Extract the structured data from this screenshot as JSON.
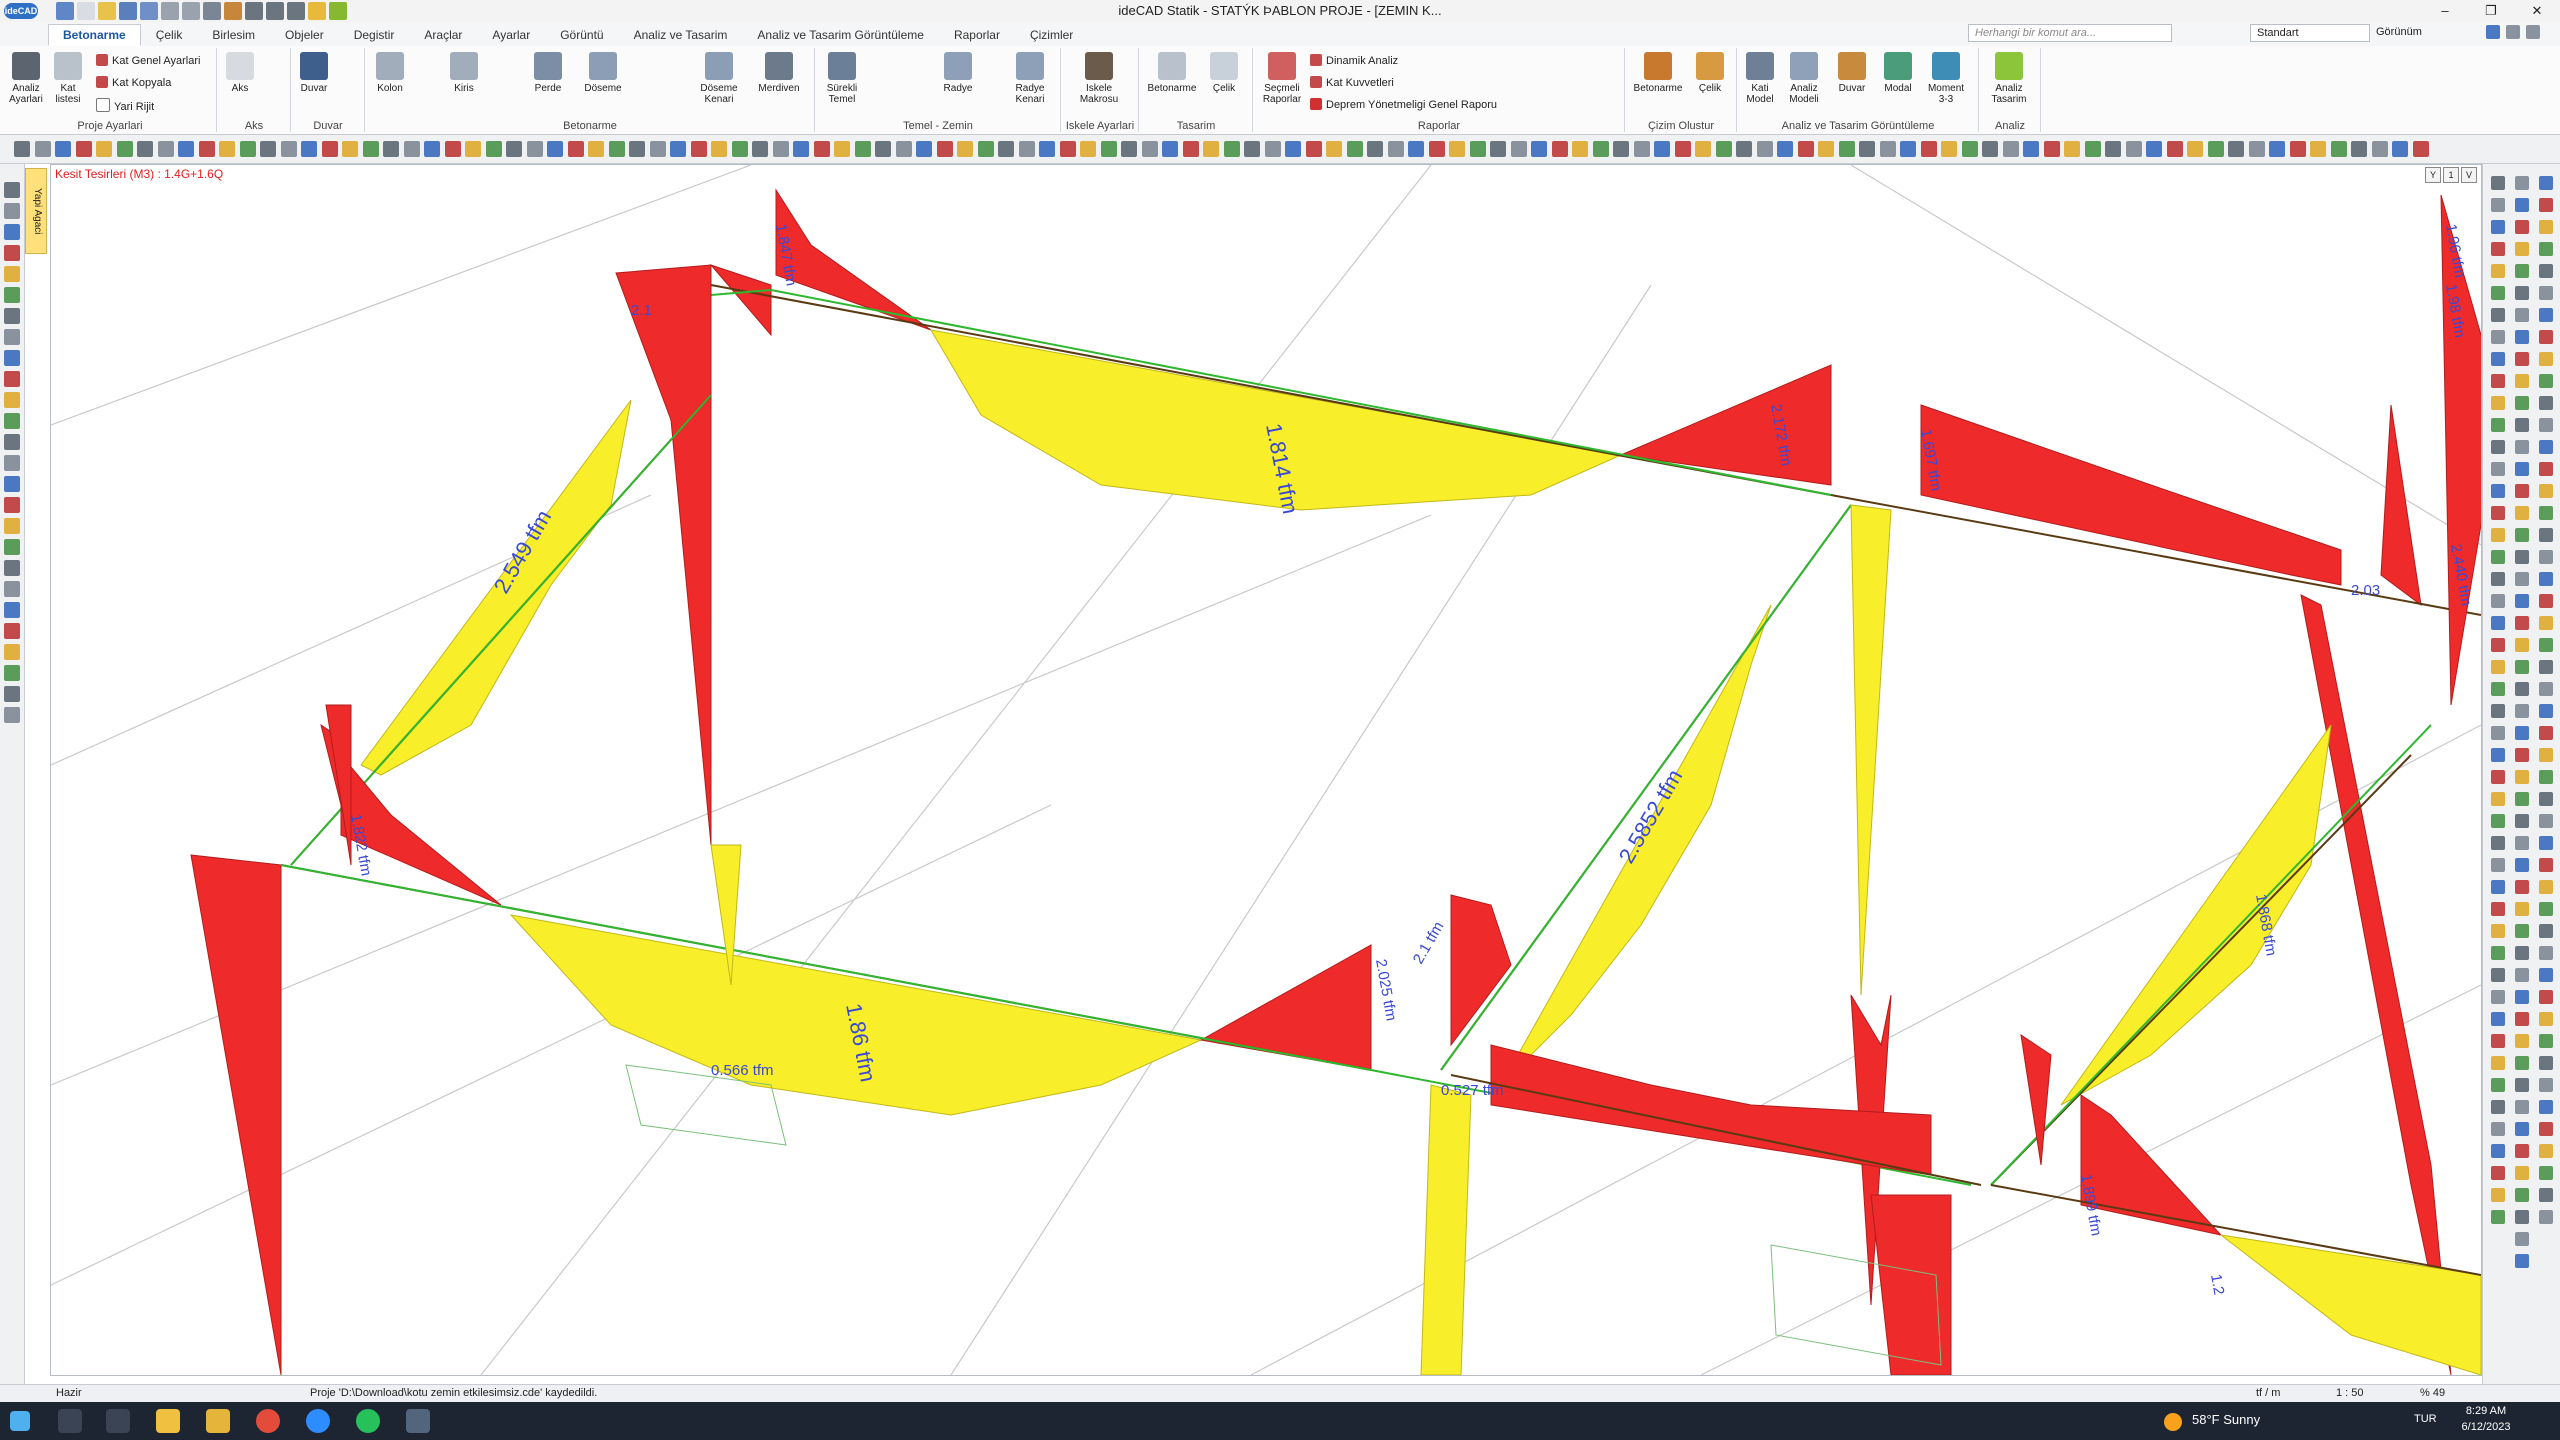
{
  "app": {
    "logo": "ideCAD",
    "window_title": "ideCAD Statik - STATÝK ÞABLON PROJE - [ZEMIN K..."
  },
  "window_controls": {
    "minimize": "–",
    "restore": "❐",
    "close": "✕"
  },
  "ribbon_tabs": [
    "Betonarme",
    "Çelik",
    "Birlesim",
    "Objeler",
    "Degistir",
    "Araçlar",
    "Ayarlar",
    "Görüntü",
    "Analiz ve Tasarim",
    "Analiz ve Tasarim Görüntüleme",
    "Raporlar",
    "Çizimler"
  ],
  "active_tab": "Betonarme",
  "search": {
    "placeholder": "Herhangi bir komut ara..."
  },
  "style_select": {
    "value": "Standart"
  },
  "view_label": "Görünüm",
  "ribbon": {
    "proje_ayarlari": {
      "label": "Proje Ayarlari",
      "analiz_ayarlari": "Analiz Ayarlari",
      "kat_listesi": "Kat listesi",
      "kat_genel_ayarlari": "Kat Genel Ayarlari",
      "kat_kopyala": "Kat Kopyala",
      "yari_rijit": "Yari Rijit"
    },
    "aks": {
      "label": "Aks",
      "aks_button": "Aks"
    },
    "duvar": {
      "label": "Duvar",
      "duvar_button": "Duvar"
    },
    "betonarme": {
      "label": "Betonarme",
      "kolon": "Kolon",
      "kiris": "Kiris",
      "perde": "Perde",
      "doseme": "Döseme",
      "doseme_kenari": "Döseme Kenari",
      "merdiven": "Merdiven"
    },
    "temel": {
      "label": "Temel - Zemin",
      "surekli_temel": "Sürekli Temel",
      "radye": "Radye",
      "radye_kenari": "Radye Kenari"
    },
    "iskele": {
      "label": "Iskele Ayarlari",
      "iskele_makrosu": "Iskele Makrosu"
    },
    "tasarim": {
      "label": "Tasarim",
      "betonarme": "Betonarme",
      "celik": "Çelik"
    },
    "raporlar": {
      "label": "Raporlar",
      "secmeli_raporlar": "Seçmeli Raporlar",
      "dinamik_analiz": "Dinamik Analiz",
      "kat_kuvvetleri": "Kat Kuvvetleri",
      "deprem_raporu": "Deprem Yönetmeligi Genel Raporu"
    },
    "cizim": {
      "label": "Çizim Olustur",
      "betonarme": "Betonarme",
      "celik": "Çelik"
    },
    "analiz_gor": {
      "label": "Analiz ve Tasarim Görüntüleme",
      "kati_model": "Kati Model",
      "analiz_modeli": "Analiz Modeli",
      "duvar": "Duvar",
      "modal": "Modal",
      "moment": "Moment 3-3"
    },
    "analiz": {
      "label": "Analiz",
      "analiz_tasarim": "Analiz Tasarim"
    }
  },
  "left_panel": {
    "yapi_agaci": "Yapi Agaci"
  },
  "viewport": {
    "info": "Kesit Tesirleri (M3) : 1.4G+1.6Q",
    "view_buttons": [
      "Y",
      "1",
      "V"
    ],
    "moment_labels": [
      "1.814 tfm",
      "1.86 tfm",
      "2.549 tfm",
      "2.5852 tfm",
      "2.172 tfm",
      "1.697 tfm",
      "2.03",
      "2.025 tfm",
      "1.847 tfm",
      "1.868 tfm",
      "0.527 tfm",
      "0.566 tfm",
      "1.96 tfm",
      "1.822 tfm",
      "2.1",
      "2.1 tfm",
      "1.899 tfm",
      "2.440 tfm",
      "1.98 tfm",
      "1.2"
    ],
    "colors": {
      "negative": "#ee2a2a",
      "positive": "#f8ee2a",
      "beam": "#5a3a12",
      "axis": "#2fb82f",
      "grid": "#c9c9c9",
      "label": "#3a49d4"
    }
  },
  "status": {
    "ready": "Hazir",
    "message": "Proje 'D:\\Download\\kotu zemin etkilesimsiz.cde' kaydedildi.",
    "unit": "tf / m",
    "scale": "1 : 50",
    "zoom": "% 49"
  },
  "taskbar": {
    "weather": "58°F  Sunny",
    "lang": "TUR",
    "time": "8:29 AM",
    "date": "6/12/2023"
  }
}
